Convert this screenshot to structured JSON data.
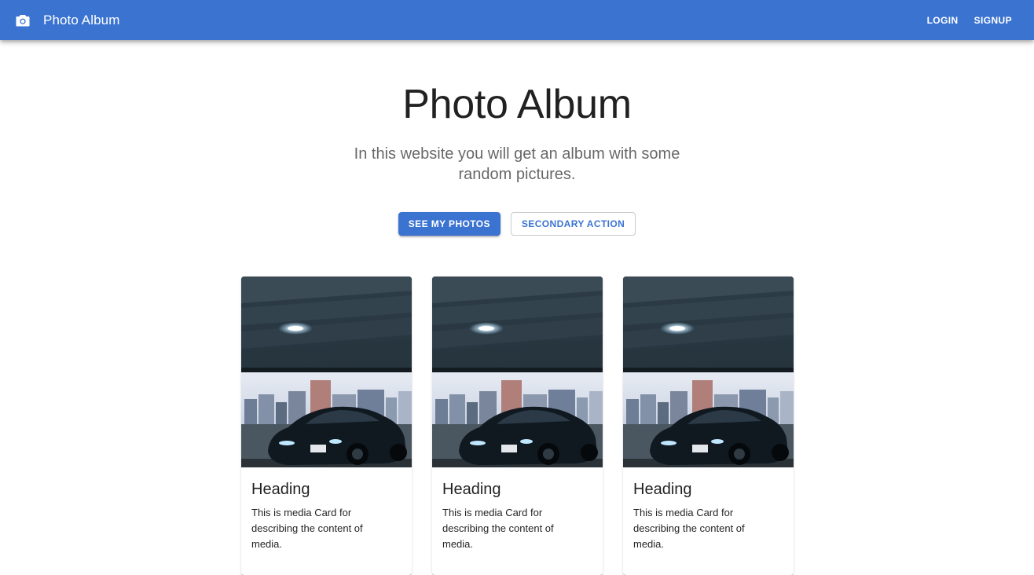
{
  "app_bar": {
    "title": "Photo Album",
    "icon": "camera-icon",
    "login_label": "LOGIN",
    "signup_label": "SIGNUP",
    "background": "#3b73d1"
  },
  "hero": {
    "title": "Photo Album",
    "subtitle": "In this website you will get an album with some random pictures.",
    "primary_action": "SEE MY PHOTOS",
    "secondary_action": "SECONDARY ACTION"
  },
  "cards": [
    {
      "heading": "Heading",
      "description": "This is media Card for describing the content of media.",
      "image": "car-photo"
    },
    {
      "heading": "Heading",
      "description": "This is media Card for describing the content of media.",
      "image": "car-photo"
    },
    {
      "heading": "Heading",
      "description": "This is media Card for describing the content of media.",
      "image": "car-photo"
    }
  ]
}
